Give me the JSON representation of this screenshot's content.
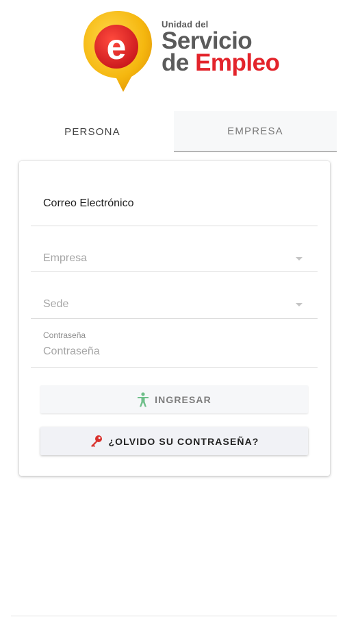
{
  "logo": {
    "line1": "Unidad del",
    "line2": "Servicio",
    "line3_prefix": "de ",
    "line3_highlight": "Empleo",
    "badge_letter": "e"
  },
  "tabs": [
    {
      "label": "PERSONA",
      "active": false
    },
    {
      "label": "EMPRESA",
      "active": true
    }
  ],
  "form": {
    "email_value": "Correo Electrónico",
    "empresa_placeholder": "Empresa",
    "sede_placeholder": "Sede",
    "password_label": "Contraseña",
    "password_placeholder": "Contraseña"
  },
  "buttons": {
    "login_label": "INGRESAR",
    "forgot_label": "¿OLVIDO SU CONTRASEÑA?"
  },
  "colors": {
    "brand_red": "#e3242b",
    "brand_yellow": "#f5b70f",
    "login_icon_green": "#6fbf8a",
    "key_icon_red": "#d9302b"
  },
  "icons": {
    "login": "person-standing-icon",
    "forgot": "key-icon"
  }
}
